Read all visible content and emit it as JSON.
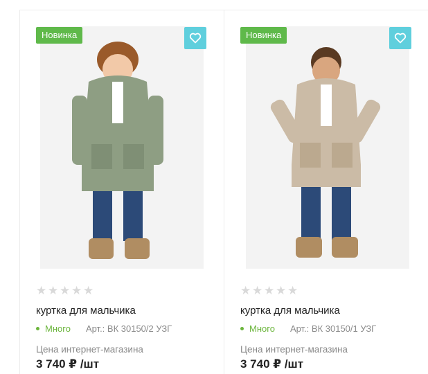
{
  "products": [
    {
      "badge": "Новинка",
      "favorite_icon": "heart-outline-icon",
      "rating_stars": 0,
      "title": "куртка для мальчика",
      "stock": "Много",
      "article": "Арт.: ВК 30150/2 УЗГ",
      "price_label": "Цена интернет-магазина",
      "price": "3 740 ₽ /шт",
      "jacket_color": "#8e9e83",
      "image_description": "boy in olive green parka"
    },
    {
      "badge": "Новинка",
      "favorite_icon": "heart-outline-icon",
      "rating_stars": 0,
      "title": "куртка для мальчика",
      "stock": "Много",
      "article": "Арт.: ВК 30150/1 УЗГ",
      "price_label": "Цена интернет-магазина",
      "price": "3 740 ₽ /шт",
      "jacket_color": "#cbbba6",
      "image_description": "boy in beige parka"
    }
  ],
  "colors": {
    "badge": "#5fb94a",
    "favorite": "#5fcfdd",
    "stock": "#6bb53c"
  }
}
